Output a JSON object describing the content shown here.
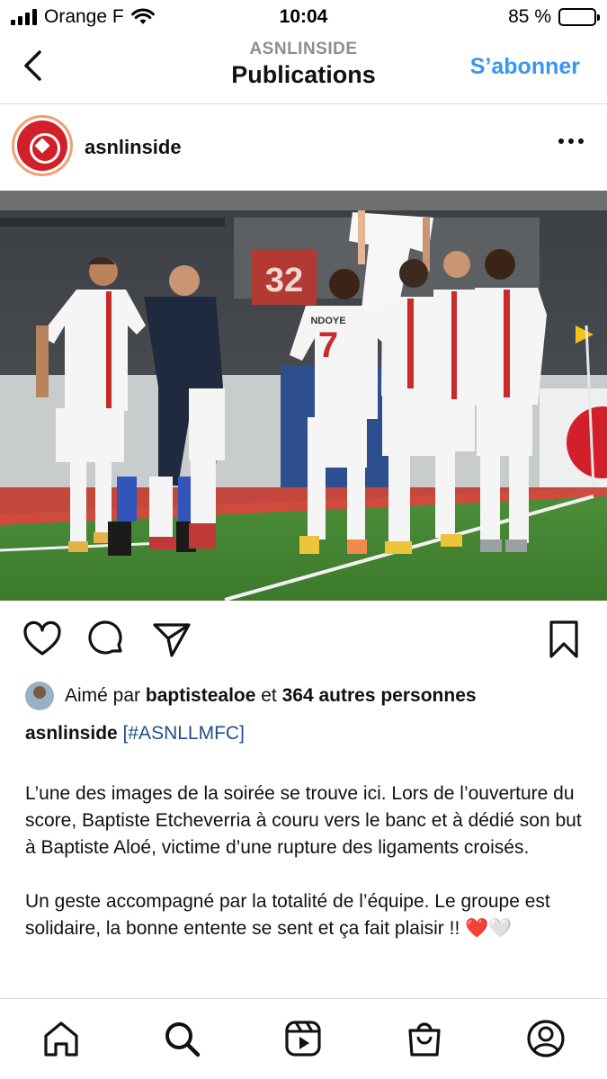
{
  "status_bar": {
    "carrier": "Orange F",
    "time": "10:04",
    "battery": "85 %",
    "battery_level": 0.85
  },
  "nav": {
    "subtitle": "ASNLINSIDE",
    "title": "Publications",
    "follow_label": "S’abonner"
  },
  "post": {
    "username": "asnlinside",
    "image_labels": {
      "stand_number": "32",
      "jersey_number": "7",
      "jersey_name": "NDOYE"
    },
    "likes": {
      "prefix": "Aimé par ",
      "user": "baptistealoe",
      "middle": " et ",
      "others": "364 autres personnes"
    },
    "caption": {
      "user": "asnlinside",
      "tag": "[#ASNLLMFC]",
      "paragraph1": "L’une des images de la soirée se trouve ici. Lors de l’ouverture du score, Baptiste Etcheverria à couru vers le banc et à dédié son but à Baptiste Aloé, victime d’une rupture des ligaments croisés.",
      "paragraph2": "Un geste accompagné par la totalité de l’équipe. Le groupe est solidaire, la bonne entente se sent et ça fait plaisir !! ❤️🤍"
    }
  },
  "icons": {
    "back": "chevron-left-icon",
    "more": "more-horizontal-icon",
    "like": "heart-icon",
    "comment": "comment-icon",
    "share": "send-icon",
    "save": "bookmark-icon",
    "home": "home-icon",
    "search": "search-icon",
    "reels": "reels-icon",
    "shop": "shop-icon",
    "profile": "profile-icon"
  },
  "colors": {
    "accent": "#3897f0",
    "hashtag": "#1f4f8a",
    "club_red": "#d2202a"
  }
}
